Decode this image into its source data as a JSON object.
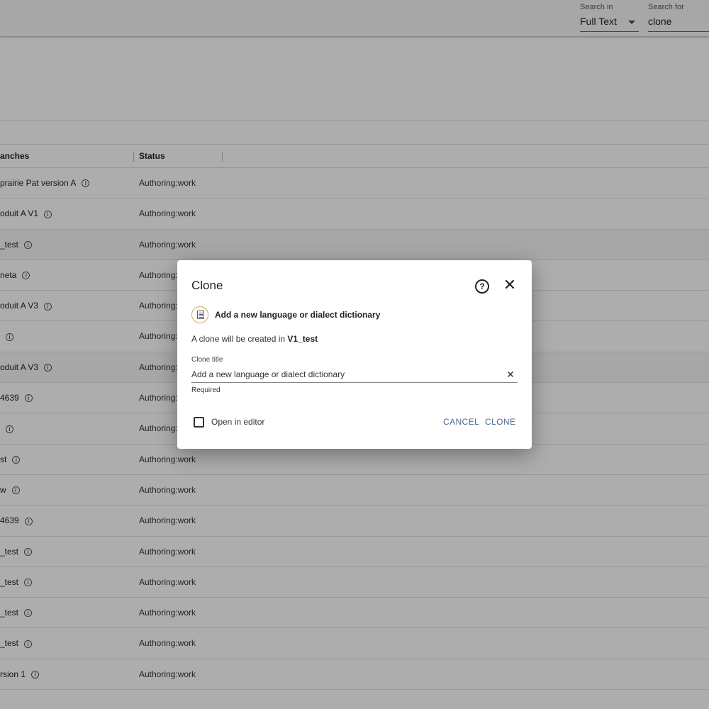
{
  "topbar": {
    "search_in": {
      "label": "Search in",
      "value": "Full Text"
    },
    "search_for": {
      "label": "Search for",
      "value": "clone"
    }
  },
  "table": {
    "headers": {
      "branches": "anches",
      "status": "Status"
    },
    "rows": [
      {
        "branch": "prairie Pat version A",
        "status": "Authoring:work"
      },
      {
        "branch": "oduit A V1",
        "status": "Authoring:work"
      },
      {
        "branch": "_test",
        "status": "Authoring:work"
      },
      {
        "branch": "neta",
        "status": "Authoring:"
      },
      {
        "branch": "oduit A V3",
        "status": "Authoring:"
      },
      {
        "branch": "",
        "status": "Authoring:"
      },
      {
        "branch": "oduit A V3",
        "status": "Authoring:"
      },
      {
        "branch": "4639",
        "status": "Authoring:"
      },
      {
        "branch": "",
        "status": "Authoring:"
      },
      {
        "branch": "st",
        "status": "Authoring:work"
      },
      {
        "branch": "w",
        "status": "Authoring:work"
      },
      {
        "branch": "4639",
        "status": "Authoring:work"
      },
      {
        "branch": "_test",
        "status": "Authoring:work"
      },
      {
        "branch": "_test",
        "status": "Authoring:work"
      },
      {
        "branch": "_test",
        "status": "Authoring:work"
      },
      {
        "branch": "_test",
        "status": "Authoring:work"
      },
      {
        "branch": "rsion 1",
        "status": "Authoring:work"
      }
    ]
  },
  "dialog": {
    "title": "Clone",
    "item_name": "Add a new language or dialect dictionary",
    "clone_info_prefix": "A clone will be created in",
    "clone_info_target": "V1_test",
    "field_label": "Clone title",
    "field_value": "Add a new language or dialect dictionary",
    "hint": "Required",
    "checkbox_label": "Open in editor",
    "cancel_label": "CANCEL",
    "clone_label": "CLONE",
    "help_glyph": "?",
    "close_glyph": "✕",
    "clear_glyph": "✕"
  },
  "icons": {
    "info": "info-icon",
    "help": "help-icon",
    "close": "close-icon",
    "document": "document-icon"
  },
  "colors": {
    "action": "#4a6a8a",
    "doc_icon_ring": "#d8a85a"
  }
}
